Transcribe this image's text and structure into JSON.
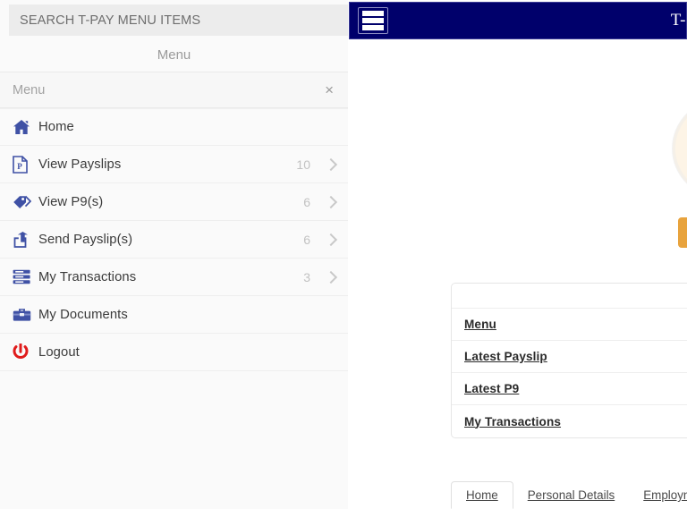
{
  "drawer": {
    "search": {
      "placeholder": "SEARCH T-PAY MENU ITEMS",
      "value": ""
    },
    "title": "Menu",
    "header": {
      "label": "Menu",
      "close_glyph": "×"
    },
    "items": [
      {
        "icon": "home-icon",
        "label": "Home",
        "count": "",
        "chevron": false
      },
      {
        "icon": "payslip-file-icon",
        "label": "View Payslips",
        "count": "10",
        "chevron": true
      },
      {
        "icon": "tag-icon",
        "label": "View P9(s)",
        "count": "6",
        "chevron": true
      },
      {
        "icon": "share-export-icon",
        "label": "Send Payslip(s)",
        "count": "6",
        "chevron": true
      },
      {
        "icon": "transactions-icon",
        "label": "My Transactions",
        "count": "3",
        "chevron": true
      },
      {
        "icon": "briefcase-icon",
        "label": "My Documents",
        "count": "",
        "chevron": false
      },
      {
        "icon": "power-logout-icon",
        "label": "Logout",
        "count": "",
        "chevron": false
      }
    ]
  },
  "app": {
    "header": {
      "menu_icon": "hamburger-menu-icon",
      "brand": "T-"
    },
    "avatar": "user-avatar-placeholder",
    "primary_button": "",
    "links_card": {
      "items": [
        {
          "label": "Menu"
        },
        {
          "label": "Latest Payslip"
        },
        {
          "label": "Latest P9"
        },
        {
          "label": "My Transactions"
        }
      ]
    },
    "tabs": [
      {
        "label": "Home",
        "active": true
      },
      {
        "label": "Personal Details",
        "active": false
      },
      {
        "label": "Employment",
        "active": false
      }
    ]
  },
  "colors": {
    "header_navy": "#00006b",
    "icon_blue": "#3f51a5",
    "logout_red": "#e01b1b",
    "accent_orange": "#e8a33d",
    "panel_bg": "#fafafa"
  }
}
